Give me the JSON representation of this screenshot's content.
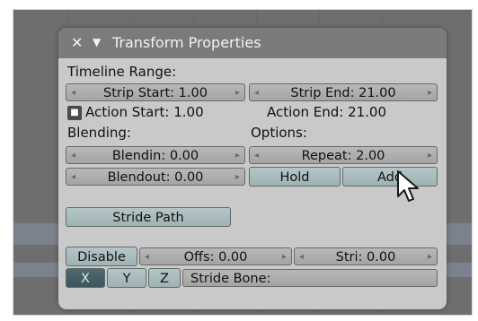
{
  "panel": {
    "close_glyph": "✕",
    "collapse_glyph": "▼",
    "title": "Transform Properties"
  },
  "timeline_range": {
    "label": "Timeline Range:",
    "strip_start": "Strip Start: 1.00",
    "strip_end": "Strip End: 21.00",
    "action_start": "Action Start: 1.00",
    "action_end": "Action End: 21.00"
  },
  "blending": {
    "label": "Blending:",
    "blendin": "Blendin: 0.00",
    "blendout": "Blendout: 0.00"
  },
  "options": {
    "label": "Options:",
    "repeat": "Repeat: 2.00",
    "hold": "Hold",
    "add": "Add"
  },
  "stride": {
    "path_button": "Stride Path",
    "disable": "Disable",
    "offs": "Offs: 0.00",
    "stri": "Stri: 0.00",
    "axis_x": "X",
    "axis_y": "Y",
    "axis_z": "Z",
    "bone_label": "Stride Bone:"
  },
  "icons": {
    "arrow_left": "◂",
    "arrow_right": "▸",
    "lock": "🔒"
  }
}
